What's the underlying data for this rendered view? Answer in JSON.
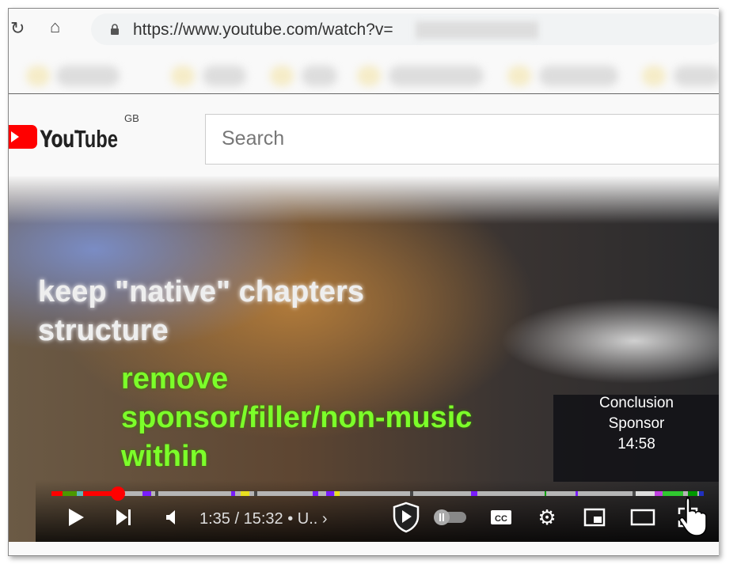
{
  "browser": {
    "url": "https://www.youtube.com/watch?v="
  },
  "youtube": {
    "logo_text": "YouTube",
    "region": "GB",
    "search_placeholder": "Search"
  },
  "overlay": {
    "line1": "keep \"native\" chapters",
    "line2": "structure",
    "green1": "remove",
    "green2": "sponsor/filler/non-music",
    "green3": "within"
  },
  "tooltip": {
    "chapter": "Conclusion",
    "segment": "Sponsor",
    "time": "14:58"
  },
  "player": {
    "time_current": "1:35",
    "time_sep": " / ",
    "time_total": "15:32",
    "chapter_label": " • U..",
    "progress_fraction": 0.102,
    "chapter_gaps": [
      0.159,
      0.311,
      0.55,
      0.891
    ],
    "segments": [
      {
        "start": 0,
        "end": 0.017,
        "color": "#ff0000"
      },
      {
        "start": 0.017,
        "end": 0.039,
        "color": "#4c9900"
      },
      {
        "start": 0.039,
        "end": 0.049,
        "color": "#5fb7b7"
      },
      {
        "start": 0.14,
        "end": 0.153,
        "color": "#7a1cff"
      },
      {
        "start": 0.275,
        "end": 0.281,
        "color": "#7a1cff"
      },
      {
        "start": 0.29,
        "end": 0.304,
        "color": "#e8e020"
      },
      {
        "start": 0.401,
        "end": 0.409,
        "color": "#7a1cff"
      },
      {
        "start": 0.421,
        "end": 0.433,
        "color": "#7a1cff"
      },
      {
        "start": 0.434,
        "end": 0.442,
        "color": "#e8e020"
      },
      {
        "start": 0.643,
        "end": 0.653,
        "color": "#7a1cff"
      },
      {
        "start": 0.756,
        "end": 0.759,
        "color": "#00a000"
      },
      {
        "start": 0.803,
        "end": 0.807,
        "color": "#7a1cff"
      },
      {
        "start": 0.891,
        "end": 0.925,
        "color": "#dddddd"
      },
      {
        "start": 0.925,
        "end": 0.937,
        "color": "#c040e0"
      },
      {
        "start": 0.937,
        "end": 0.968,
        "color": "#30c830"
      },
      {
        "start": 0.976,
        "end": 0.99,
        "color": "#009900"
      },
      {
        "start": 0.993,
        "end": 1,
        "color": "#2030c0"
      }
    ]
  }
}
